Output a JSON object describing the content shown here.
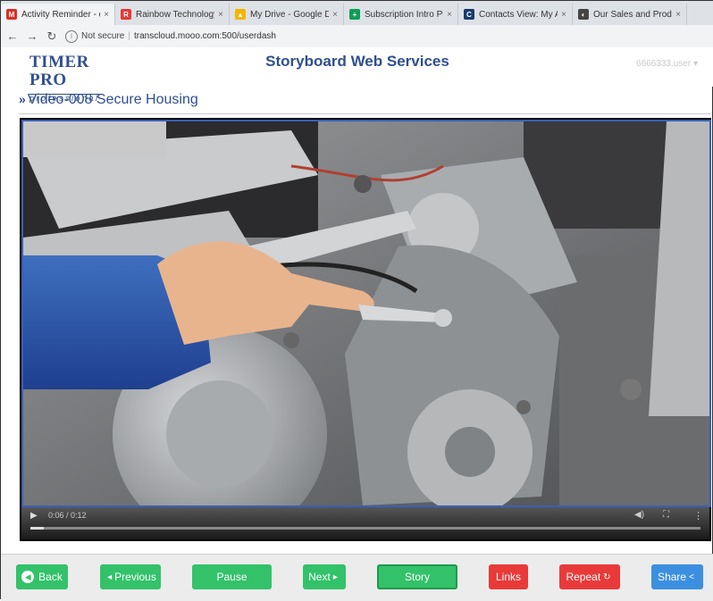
{
  "browser": {
    "tabs": [
      {
        "title": "Activity Reminder - dy",
        "favicon": "gmail-icon",
        "color": "#d93025",
        "glyph": "M"
      },
      {
        "title": "Rainbow Technology l",
        "favicon": "rainbow-icon",
        "color": "#e53935",
        "glyph": "R"
      },
      {
        "title": "My Drive - Google Dri",
        "favicon": "google-drive-icon",
        "color": "#f4b400",
        "glyph": "▲"
      },
      {
        "title": "Subscription Intro Plan",
        "favicon": "sheets-icon",
        "color": "#0f9d58",
        "glyph": "+"
      },
      {
        "title": "Contacts View: My Ac",
        "favicon": "contacts-icon",
        "color": "#1a3a6e",
        "glyph": "C"
      },
      {
        "title": "Our Sales and Product",
        "favicon": "sales-icon",
        "color": "#444444",
        "glyph": "◐"
      }
    ],
    "security_label": "Not secure",
    "url": "transcloud.mooo.com:500/userdash"
  },
  "header": {
    "logo_main": "TIMER PRO",
    "logo_sub": "professional",
    "title": "Storyboard Web Services",
    "user": "6666333.user ▾"
  },
  "video": {
    "chevron": "»",
    "title": "Video-008 Secure Housing",
    "time": "0:06 / 0:12",
    "progress": 0.02
  },
  "buttons": {
    "back": "Back",
    "previous": "Previous",
    "pause": "Pause",
    "next": "Next",
    "story": "Story",
    "links": "Links",
    "repeat": "Repeat",
    "share": "Share"
  },
  "colors": {
    "accent": "#2f4f8f",
    "green": "#33c26a",
    "red": "#e93a3a",
    "blue": "#3c8fe0"
  }
}
